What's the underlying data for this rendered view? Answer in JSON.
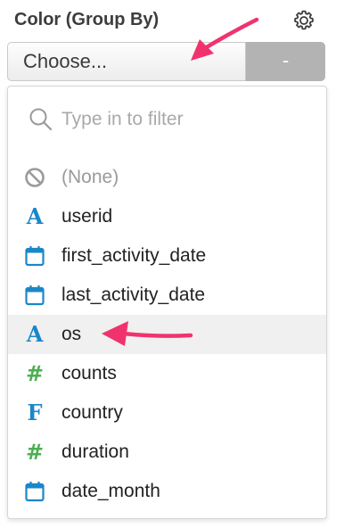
{
  "header": {
    "title": "Color (Group By)",
    "settings_icon": "gear-icon"
  },
  "select": {
    "button_label": "Choose...",
    "remove_label": "-"
  },
  "dropdown": {
    "search_placeholder": "Type in to filter",
    "items": [
      {
        "label": "(None)",
        "type": "none",
        "icon": "none-icon"
      },
      {
        "label": "userid",
        "type": "character",
        "icon": "character-type-icon"
      },
      {
        "label": "first_activity_date",
        "type": "date",
        "icon": "calendar-icon"
      },
      {
        "label": "last_activity_date",
        "type": "date",
        "icon": "calendar-icon"
      },
      {
        "label": "os",
        "type": "character",
        "icon": "character-type-icon",
        "highlighted": true
      },
      {
        "label": "counts",
        "type": "numeric",
        "icon": "numeric-type-icon"
      },
      {
        "label": "country",
        "type": "factor",
        "icon": "factor-type-icon"
      },
      {
        "label": "duration",
        "type": "numeric",
        "icon": "numeric-type-icon"
      },
      {
        "label": "date_month",
        "type": "date",
        "icon": "calendar-icon"
      }
    ]
  },
  "colors": {
    "accent_blue": "#1a87c9",
    "numeric_green": "#4caf50",
    "annotation_pink": "#f0336d",
    "hover_bg": "#f0f0f0"
  }
}
